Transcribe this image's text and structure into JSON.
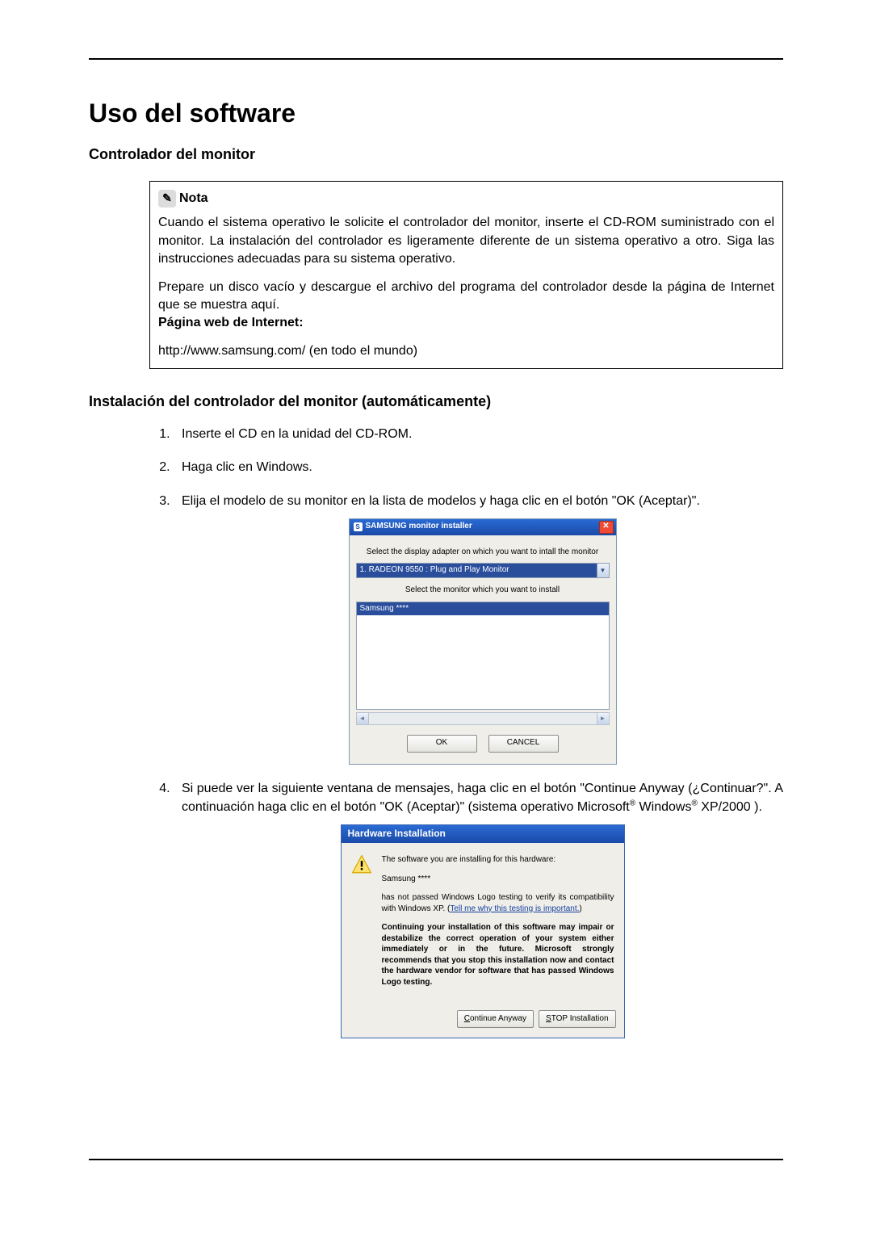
{
  "title": "Uso del software",
  "subtitle": "Controlador del monitor",
  "note": {
    "label": "Nota",
    "p1": "Cuando el sistema operativo le solicite el controlador del monitor, inserte el CD-ROM suministrado con el monitor. La instalación del controlador es liger­amente diferente de un sistema operativo a otro. Siga las instrucciones adecuadas para su sistema operativo.",
    "p2": "Prepare un disco vacío y descargue el archivo del programa del controlador desde la página de Internet que se muestra aquí.",
    "web_label": "Página web de Internet:",
    "url": "http://www.samsung.com/ (en todo el mundo)"
  },
  "section2_title": "Instalación del controlador del monitor (automáticamente)",
  "steps": {
    "s1": "Inserte el CD en la unidad del CD-ROM.",
    "s2": "Haga clic en Windows.",
    "s3": "Elija el modelo de su monitor en la lista de modelos y haga clic en el botón \"OK (Aceptar)\".",
    "s4_a": "Si puede ver la siguiente ventana de mensajes, haga clic en el botón \"Continue Anyway (¿Continuar?\". A continuación haga clic en el botón \"OK (Aceptar)\" (sistema operativo Microsoft",
    "s4_b": " Windows",
    "s4_c": " XP/2000 )."
  },
  "installer": {
    "title": "SAMSUNG monitor installer",
    "label1": "Select the display adapter on which you want to intall the monitor",
    "adapter": "1. RADEON 9550 : Plug and Play Monitor",
    "label2": "Select the monitor which you want to install",
    "monitor": "Samsung ****",
    "ok": "OK",
    "cancel": "CANCEL"
  },
  "warning": {
    "title": "Hardware Installation",
    "line1": "The software you are installing for this hardware:",
    "product": "Samsung ****",
    "line2a": "has not passed Windows Logo testing to verify its compatibility with Windows XP. (",
    "link": "Tell me why this testing is important.",
    "line2b": ")",
    "bold": "Continuing your installation of this software may impair or destabilize the correct operation of your system either immediately or in the future. Microsoft strongly recommends that you stop this installation now and contact the hardware vendor for software that has passed Windows Logo testing.",
    "btn_continue": "Continue Anyway",
    "btn_stop": "STOP Installation"
  }
}
